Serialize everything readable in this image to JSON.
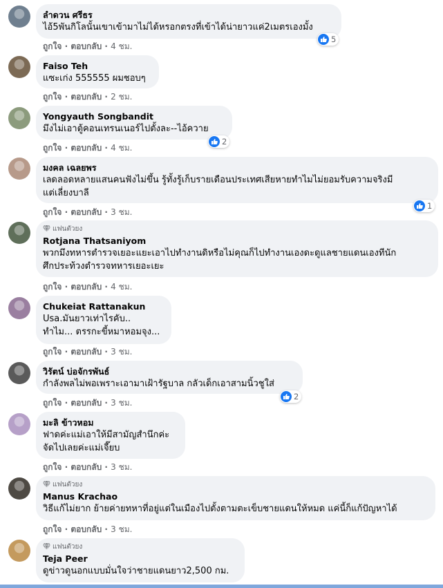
{
  "colors": {
    "bubble": "#f0f2f5",
    "like": "#1877f2",
    "meta": "#65676b"
  },
  "action_labels": {
    "like": "ถูกใจ",
    "reply": "ตอบกลับ"
  },
  "comments": [
    {
      "avatar_color": "#6f7f8f",
      "author": "ลำดวน ศรีธร",
      "text": "ไอ้5พันกิโลนั้นเขาเข้ามาไม่ได้หรอกตรงที่เข้าได้น่ายาวแค่2เมตรเองมั้ง",
      "time": "4 ชม.",
      "likes": "5"
    },
    {
      "avatar_color": "#7c6a55",
      "author": "Faiso Teh",
      "text": "แซะเก่ง 555555 ผมชอบๆ",
      "time": "2 ชม."
    },
    {
      "avatar_color": "#8c9b7d",
      "author": "Yongyauth Songbandit",
      "text": "มึงไม่เอาตู้คอนเทรนเนอร์ไปตั้งละ--ไอ้ควาย",
      "time": "4 ชม.",
      "likes": "2"
    },
    {
      "avatar_color": "#b79a8a",
      "author": "มงคล เฉลยพร",
      "text": "เลดลอดหลายแสนคนฟังไม่ขึ้น รู้ทั้งรู้เก็บรายเดือนประเทศเสียหายทำไมไม่ยอมรับความจริงมี\nแต่เลี่ยงบาลี",
      "time": "3 ชม.",
      "likes": "1"
    },
    {
      "avatar_color": "#5f6f5a",
      "badge": "แฟนตัวยง",
      "author": "Rotjana Thatsaniyom",
      "text": "พวกมึงทหารตำรวจเยอะแยะเอาไปทำงานดิหรือไม่คุณก็ไปทำงานเองดะดูแลชายแดนเองทีนัก\nศึกประท้วงตำรวจทหารเยอะเยะ",
      "time": "4 ชม."
    },
    {
      "avatar_color": "#9a7fa0",
      "author": "Chukeiat Rattanakun",
      "text": "Usa.มันยาวเท่าไรคับ..\nทำไม... ตรรกะขี้หมาหอมจุง...",
      "time": "3 ชม."
    },
    {
      "avatar_color": "#5a5a5a",
      "author": "วิรัตน์ บ่อจักรพันธ์",
      "text": "กำลังพลไม่พอเพราะเอามาเฝ้ารัฐบาล กลัวเด็กเอาสามนิ้วชูใส่",
      "time": "3 ชม.",
      "likes": "2"
    },
    {
      "avatar_color": "#b6a0c8",
      "author": "มะลิ ข้าวหอม",
      "text": "ฟาดค่ะแม่เอาให้มีสามัญสำนึกค่ะ\nจัดไปเลยค่ะแม่เจี๊ยบ",
      "time": "3 ชม."
    },
    {
      "avatar_color": "#4e4a44",
      "badge": "แฟนตัวยง",
      "author": "Manus Krachao",
      "text": "วิธีแก้ไม่ยาก ย้ายค่ายทหาที่อยู่แต่ในเมืองไปตั้งตามตะเข็บชายแดนให้หมด แค่นี้ก็แก้ปัญหาได้",
      "time": "3 ชม."
    },
    {
      "avatar_color": "#c49a5e",
      "badge": "แฟนตัวยง",
      "author": "Teja Peer",
      "text": "ดูข่าวดูนอกแบบมั่นใจว่าชายแดนยาว2,500 กม."
    }
  ]
}
